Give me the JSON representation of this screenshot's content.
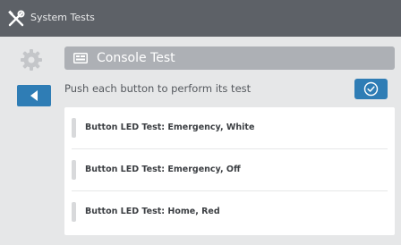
{
  "header": {
    "title": "System Tests",
    "icon": "tools-icon"
  },
  "sidebar": {
    "settings_icon": "gear-icon",
    "back_icon": "back-arrow-icon"
  },
  "panel": {
    "title": "Console Test",
    "title_icon": "console-icon",
    "instruction": "Push each button to perform its test",
    "confirm_icon": "check-circle-icon"
  },
  "tests": [
    {
      "label": "Button LED Test: Emergency, White"
    },
    {
      "label": "Button LED Test: Emergency, Off"
    },
    {
      "label": "Button LED Test: Home, Red"
    }
  ],
  "colors": {
    "topbar": "#5d6167",
    "background": "#e6e7e8",
    "accent": "#2f7db5",
    "panel_header": "#adb0b5"
  }
}
